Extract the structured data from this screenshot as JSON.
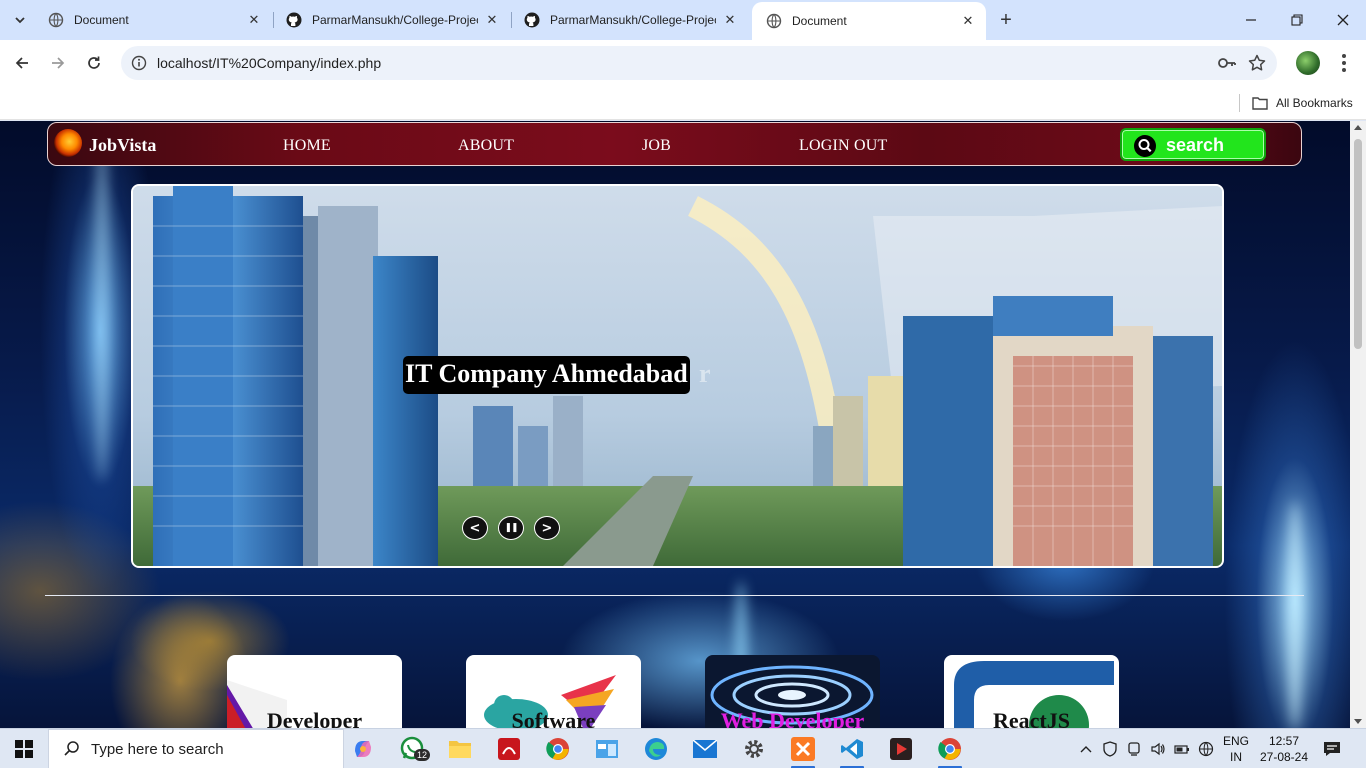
{
  "browser": {
    "tabs": [
      {
        "title": "Document",
        "favicon": "globe-icon",
        "active": false
      },
      {
        "title": "ParmarMansukh/College-Projec",
        "favicon": "github-icon",
        "active": false
      },
      {
        "title": "ParmarMansukh/College-Projec",
        "favicon": "github-icon",
        "active": false
      },
      {
        "title": "Document",
        "favicon": "globe-icon",
        "active": true
      }
    ],
    "new_tab": "+",
    "url": "localhost/IT%20Company/index.php",
    "bookmarks_all": "All Bookmarks"
  },
  "site": {
    "logo_text": "JobVista",
    "nav": [
      "HOME",
      "ABOUT",
      "JOB",
      "LOGIN OUT"
    ],
    "search_label": "search",
    "hero_caption": "IT Company Ahmedabad",
    "hero_ghost_char": "r",
    "slider_controls": {
      "prev": "<",
      "pause": "❚❚",
      "next": ">"
    },
    "cards": [
      {
        "label": "Developer",
        "color": "#111111"
      },
      {
        "label": "Software",
        "color": "#111111"
      },
      {
        "label": "Web Developer",
        "color": "#e01ee0"
      },
      {
        "label": "ReactJS",
        "color": "#111111"
      }
    ]
  },
  "taskbar": {
    "search_placeholder": "Type here to search",
    "whatsapp_badge": "12",
    "lang_line1": "ENG",
    "lang_line2": "IN",
    "time": "12:57",
    "date": "27-08-24"
  },
  "colors": {
    "nav_bg": "#6a0a16",
    "search_green": "#22e51c",
    "chrome_tabstrip": "#d3e3fd"
  }
}
